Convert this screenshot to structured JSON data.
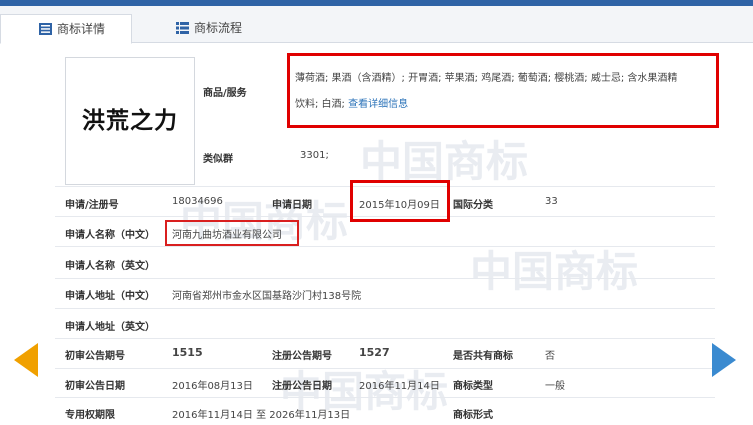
{
  "tabs": {
    "detail_label": "商标详情",
    "flow_label": "商标流程"
  },
  "watermark": {
    "text": "中国商标"
  },
  "logo": {
    "text": "洪荒之力"
  },
  "goods": {
    "label": "商品/服务",
    "line1": "薄荷酒; 果酒（含酒精）; 开胃酒; 苹果酒; 鸡尾酒; 葡萄酒; 樱桃酒; 威士忌; 含水果酒精",
    "line2": "饮料; 白酒;",
    "link": "查看详细信息"
  },
  "similar_group": {
    "label": "类似群",
    "value": "3301;"
  },
  "reg_no": {
    "label": "申请/注册号",
    "value": "18034696"
  },
  "apply_date": {
    "label": "申请日期",
    "value": "2015年10月09日"
  },
  "intl_class": {
    "label": "国际分类",
    "value": "33"
  },
  "applicant_cn": {
    "label": "申请人名称（中文）",
    "value": "河南九曲坊酒业有限公司"
  },
  "applicant_en": {
    "label": "申请人名称（英文）",
    "value": ""
  },
  "address_cn": {
    "label": "申请人地址（中文）",
    "value": "河南省郑州市金水区国基路沙门村138号院"
  },
  "address_en": {
    "label": "申请人地址（英文）",
    "value": ""
  },
  "prelim_no": {
    "label": "初审公告期号",
    "value": "1515"
  },
  "reg_notice_no": {
    "label": "注册公告期号",
    "value": "1527"
  },
  "shared": {
    "label": "是否共有商标",
    "value": "否"
  },
  "prelim_date": {
    "label": "初审公告日期",
    "value": "2016年08月13日"
  },
  "reg_notice_date": {
    "label": "注册公告日期",
    "value": "2016年11月14日"
  },
  "tm_type": {
    "label": "商标类型",
    "value": "一般"
  },
  "exclusive_period": {
    "label": "专用权期限",
    "value": "2016年11月14日 至 2026年11月13日"
  },
  "tm_form": {
    "label": "商标形式",
    "value": ""
  },
  "colors": {
    "highlight_red": "#e00000",
    "link_blue": "#2a72b8",
    "prev_arrow": "#f0a000",
    "next_arrow": "#3a8ad0"
  }
}
